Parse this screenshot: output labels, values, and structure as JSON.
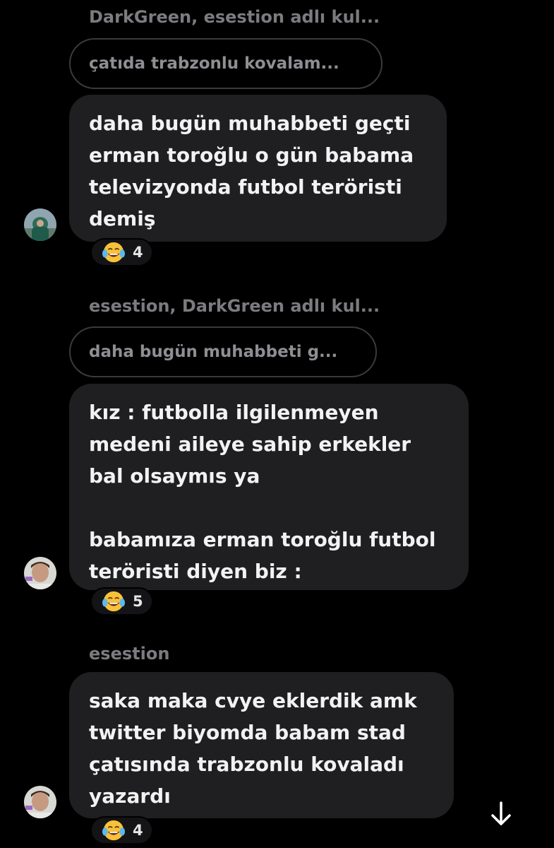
{
  "messages": [
    {
      "sender_line": "DarkGreen, esestion adlı kul...",
      "reply_preview": "çatıda trabzonlu kovalam...",
      "text": "daha bugün muhabbeti geçti\nerman toroğlu o gün babama\ntelevizyonda futbol teröristi\ndemiş",
      "reaction": {
        "emoji": "face-with-tears-of-joy-emoji",
        "count": "4"
      }
    },
    {
      "sender_line": "esestion, DarkGreen adlı kul...",
      "reply_preview": "daha bugün muhabbeti g...",
      "text": "kız : futbolla ilgilenmeyen\nmedeni aileye sahip erkekler\nbal olsaymıs ya\n\nbabamıza erman toroğlu futbol\nteröristi diyen biz :",
      "reaction": {
        "emoji": "face-with-tears-of-joy-emoji",
        "count": "5"
      }
    },
    {
      "sender_line": "esestion",
      "text": "saka maka cvye eklerdik amk\ntwitter biyomda babam stad\nçatısında trabzonlu kovaladı\nyazardı",
      "reaction": {
        "emoji": "face-with-tears-of-joy-emoji",
        "count": "4"
      }
    }
  ],
  "icons": {
    "scroll_down": "arrow-down-icon"
  },
  "colors": {
    "background": "#000000",
    "bubble": "#1f1f21",
    "sender_text": "#7b7b80",
    "reply_border": "#3a3a3c"
  }
}
